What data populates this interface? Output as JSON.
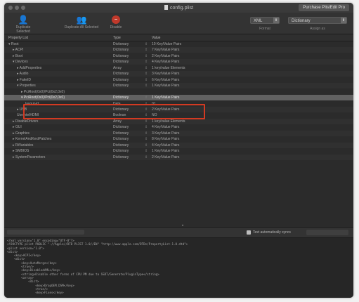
{
  "window": {
    "title": "config.plist",
    "purchase_label": "Purchase PlistEdit Pro"
  },
  "toolbar": {
    "duplicate_label": "Duplicate Selected",
    "duplicate_all_label": "Duplicate All Selected",
    "disable_label": "Disable",
    "format_value": "XML",
    "format_label": "Format",
    "assign_value": "Dictionary",
    "assign_label": "Assign as"
  },
  "columns": {
    "key": "Property List",
    "type": "Type",
    "value": "Value"
  },
  "rows": [
    {
      "key": "Root",
      "type": "Dictionary",
      "value": "10 Key/Value Pairs",
      "level": 0,
      "expanded": true
    },
    {
      "key": "ACPI",
      "type": "Dictionary",
      "value": "7 Key/Value Pairs",
      "level": 1,
      "expanded": false
    },
    {
      "key": "Boot",
      "type": "Dictionary",
      "value": "2 Key/Value Pairs",
      "level": 1,
      "expanded": false
    },
    {
      "key": "Devices",
      "type": "Dictionary",
      "value": "4 Key/Value Pairs",
      "level": 1,
      "expanded": true
    },
    {
      "key": "AddProperties",
      "type": "Array",
      "value": "1 key/value Elements",
      "level": 2,
      "expanded": false
    },
    {
      "key": "Audio",
      "type": "Dictionary",
      "value": "3 Key/Value Pairs",
      "level": 2,
      "expanded": false
    },
    {
      "key": "FakeID",
      "type": "Dictionary",
      "value": "6 Key/Value Pairs",
      "level": 2,
      "expanded": false
    },
    {
      "key": "Properties",
      "type": "Dictionary",
      "value": "1 Key/Value Pairs",
      "level": 2,
      "expanded": true
    },
    {
      "key": "PciRoot(0x0)/Pci(0x2,0x0)",
      "type": "",
      "value": "",
      "level": 3,
      "expanded": false
    },
    {
      "key": "PciRoot(0x0)/Pci(0x2,0x0)",
      "type": "Dictionary",
      "value": "1 Key/Value Pairs",
      "level": 3,
      "expanded": true,
      "selected": true
    },
    {
      "key": "layout-id",
      "type": "Data",
      "value": "01",
      "level": 4
    },
    {
      "key": "USB",
      "type": "Dictionary",
      "value": "2 Key/Value Pairs",
      "level": 2,
      "expanded": false
    },
    {
      "key": "UseIntelHDMI",
      "type": "Boolean",
      "value": "NO",
      "level": 2
    },
    {
      "key": "DisableDrivers",
      "type": "Array",
      "value": "1 key/value Elements",
      "level": 1,
      "expanded": false
    },
    {
      "key": "GUI",
      "type": "Dictionary",
      "value": "4 Key/Value Pairs",
      "level": 1,
      "expanded": false
    },
    {
      "key": "Graphics",
      "type": "Dictionary",
      "value": "3 Key/Value Pairs",
      "level": 1,
      "expanded": false
    },
    {
      "key": "KernelAndKextPatches",
      "type": "Dictionary",
      "value": "8 Key/Value Pairs",
      "level": 1,
      "expanded": false
    },
    {
      "key": "RtVariables",
      "type": "Dictionary",
      "value": "4 Key/Value Pairs",
      "level": 1,
      "expanded": false
    },
    {
      "key": "SMBIOS",
      "type": "Dictionary",
      "value": "1 Key/Value Pairs",
      "level": 1,
      "expanded": false
    },
    {
      "key": "SystemParameters",
      "type": "Dictionary",
      "value": "2 Key/Value Pairs",
      "level": 1,
      "expanded": false
    }
  ],
  "bottom": {
    "auto_sync_label": "Text automatically syncs"
  },
  "xml_lines": [
    "<?xml version=\"1.0\" encoding=\"UTF-8\"?>",
    "<!DOCTYPE plist PUBLIC \"-//Apple//DTD PLIST 1.0//EN\" \"http://www.apple.com/DTDs/PropertyList-1.0.dtd\">",
    "<plist version=\"1.0\">",
    "<dict>",
    "    <key>ACPI</key>",
    "    <dict>",
    "        <key>AutoMerge</key>",
    "        <true/>",
    "        <key>DisabledAML</key>",
    "        <string>Disable other forms of CPU PM due to SSDT/Generate/PluginType</string>",
    "        <array>",
    "            <dict>",
    "                <key>DropOEM_DSM</key>",
    "                <true/>",
    "                <key>Fixes</key>"
  ]
}
